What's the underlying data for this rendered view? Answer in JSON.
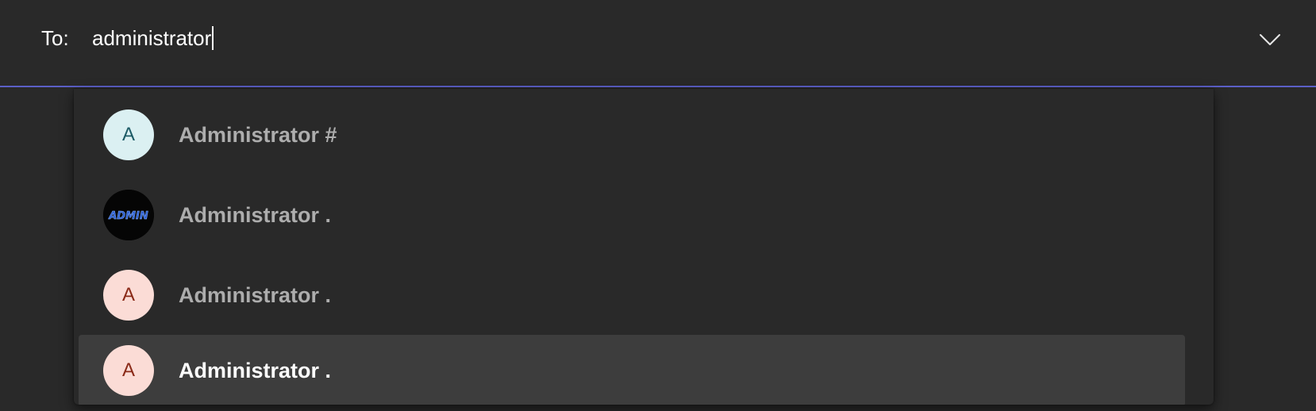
{
  "to_field": {
    "label": "To:",
    "value": "administrator"
  },
  "suggestions": [
    {
      "name": "Administrator #",
      "avatar_initial": "A",
      "avatar_style": "teal",
      "selected": false
    },
    {
      "name": "Administrator .",
      "avatar_initial": "",
      "avatar_image_text": "ADMIN",
      "avatar_style": "dark",
      "selected": false
    },
    {
      "name": "Administrator .",
      "avatar_initial": "A",
      "avatar_style": "salmon",
      "selected": false
    },
    {
      "name": "Administrator .",
      "avatar_initial": "A",
      "avatar_style": "salmon",
      "selected": true
    }
  ],
  "colors": {
    "background": "#292929",
    "accent_underline": "#5b5fc7",
    "selected_row": "#3d3d3d",
    "muted_text": "#adadad"
  },
  "icons": {
    "expand": "chevron-down-icon"
  }
}
